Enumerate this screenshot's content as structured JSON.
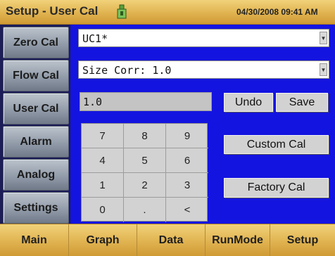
{
  "title_bar": {
    "title": "Setup - User Cal",
    "usb_icon": "usb-icon",
    "datetime": "04/30/2008 09:41 AM"
  },
  "sidebar": {
    "items": [
      {
        "label": "Zero Cal"
      },
      {
        "label": "Flow Cal"
      },
      {
        "label": "User Cal"
      },
      {
        "label": "Alarm"
      },
      {
        "label": "Analog"
      },
      {
        "label": "Settings"
      }
    ]
  },
  "main": {
    "cal_select": {
      "value": "UC1*",
      "arrow_icon": "chevron-down-icon"
    },
    "size_corr_select": {
      "value": "Size Corr: 1.0",
      "arrow_icon": "chevron-down-icon"
    },
    "value_field": "1.0",
    "undo_label": "Undo",
    "save_label": "Save",
    "custom_cal_label": "Custom Cal",
    "factory_cal_label": "Factory Cal",
    "keypad": {
      "keys": [
        "7",
        "8",
        "9",
        "4",
        "5",
        "6",
        "1",
        "2",
        "3",
        "0",
        ".",
        "<"
      ]
    }
  },
  "bottom_tabs": [
    {
      "label": "Main"
    },
    {
      "label": "Graph"
    },
    {
      "label": "Data"
    },
    {
      "label": "RunMode"
    },
    {
      "label": "Setup"
    }
  ],
  "colors": {
    "title_bar": "#e0b350",
    "main_panel": "#1414e0",
    "button": "#d2d2d2",
    "sidebar_button": "#8e98a6"
  }
}
